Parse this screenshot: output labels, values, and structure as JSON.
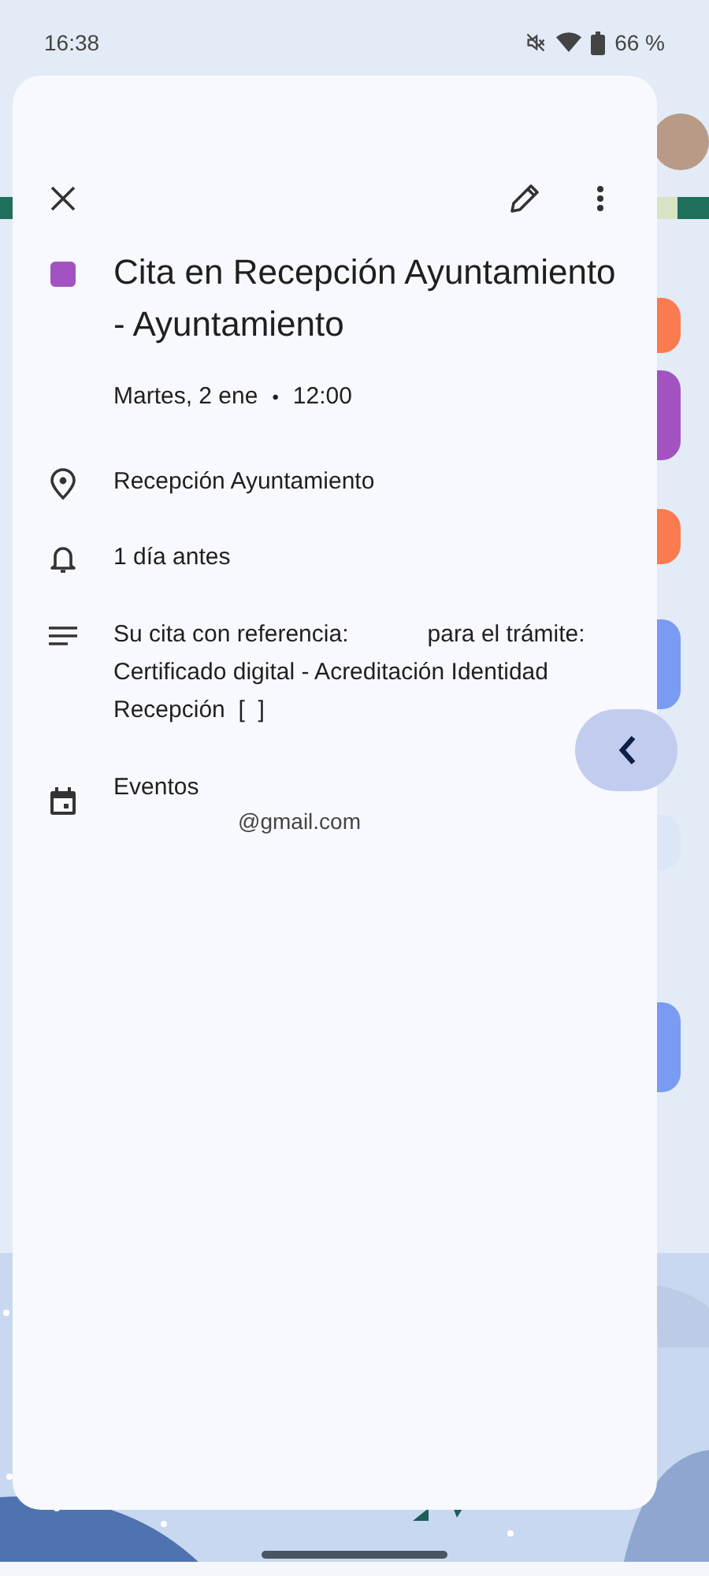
{
  "status_bar": {
    "time": "16:38",
    "battery": "66 %"
  },
  "background_events": [
    {
      "color": "#fa7b4f"
    },
    {
      "color": "#a353c1"
    },
    {
      "color": "#fa7b4f"
    },
    {
      "color": "#7a9bf2"
    },
    {
      "color": "#dce6f7"
    },
    {
      "color": "#7a9bf2"
    }
  ],
  "event": {
    "color": "#a353c1",
    "title": "Cita en Recepción Ayuntamiento - Ayuntamiento",
    "date": "Martes, 2 ene",
    "separator": "•",
    "time": "12:00",
    "location": "Recepción Ayuntamiento",
    "reminder": "1 día antes",
    "description": "Su cita con referencia:            para el trámite: Certificado digital - Acreditación Identidad Recepción  [  ]",
    "calendar": "Eventos",
    "account": "@gmail.com"
  }
}
